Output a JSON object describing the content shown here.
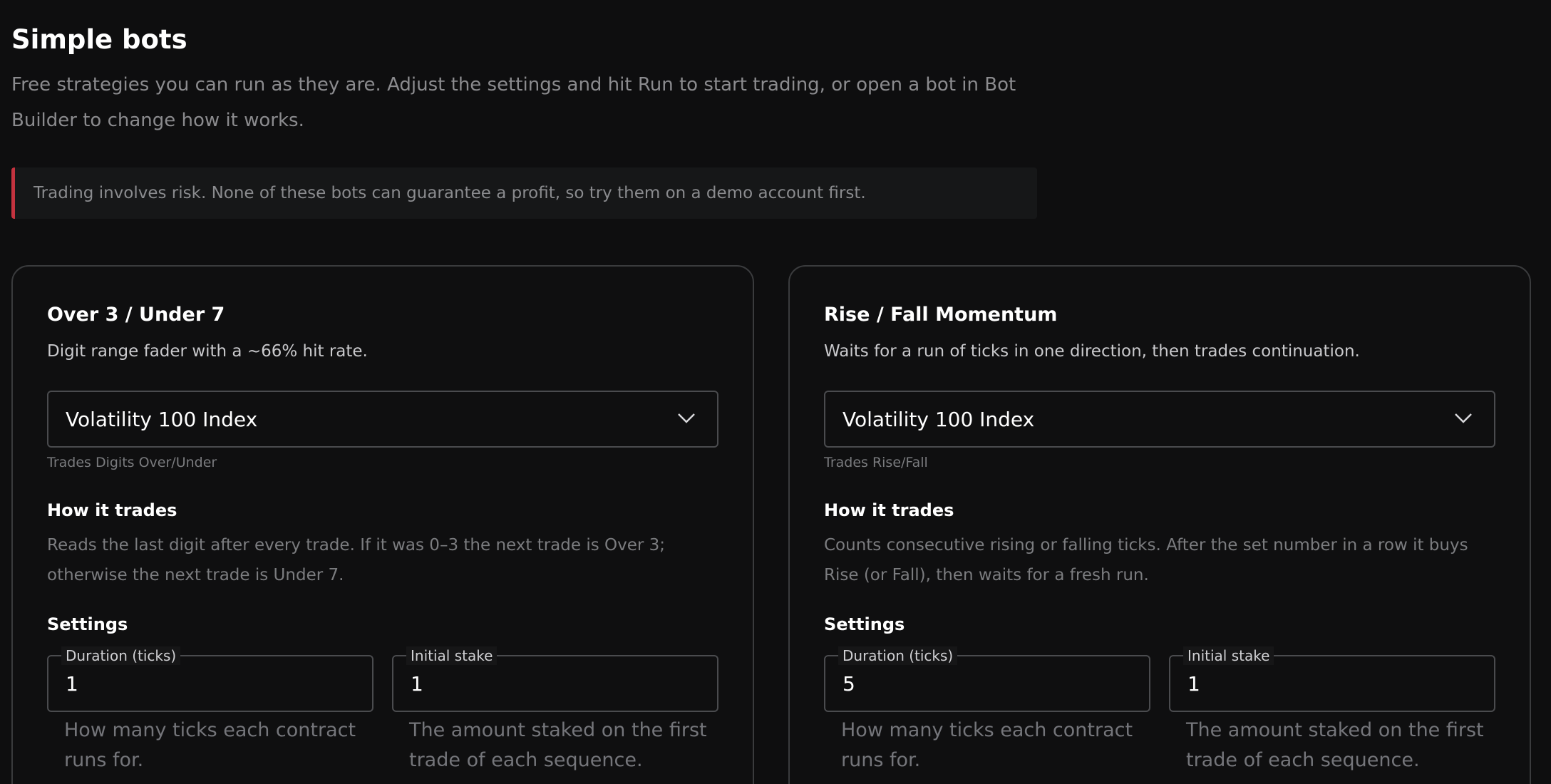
{
  "page": {
    "title": "Simple bots",
    "intro": "Free strategies you can run as they are. Adjust the settings and hit Run to start trading, or open a bot in Bot Builder to change how it works.",
    "warning": "Trading involves risk. None of these bots can guarantee a profit, so try them on a demo account first.",
    "warning_accent_color": "#c4333f"
  },
  "bots": [
    {
      "title": "Over 3 / Under 7",
      "description": "Digit range fader with a ~66% hit rate.",
      "market_select": "Volatility 100 Index",
      "market_help": "Trades Digits Over/Under",
      "how_heading": "How it trades",
      "how_text": "Reads the last digit after every trade. If it was 0–3 the next trade is Over 3; otherwise the next trade is Under 7.",
      "settings_heading": "Settings",
      "duration_label": "Duration (ticks)",
      "duration_value": "1",
      "duration_help": "How many ticks each contract runs for.",
      "stake_label": "Initial stake",
      "stake_value": "1",
      "stake_help": "The amount staked on the first trade of each sequence."
    },
    {
      "title": "Rise / Fall Momentum",
      "description": "Waits for a run of ticks in one direction, then trades continuation.",
      "market_select": "Volatility 100 Index",
      "market_help": "Trades Rise/Fall",
      "how_heading": "How it trades",
      "how_text": "Counts consecutive rising or falling ticks. After the set number in a row it buys Rise (or Fall), then waits for a fresh run.",
      "settings_heading": "Settings",
      "duration_label": "Duration (ticks)",
      "duration_value": "5",
      "duration_help": "How many ticks each contract runs for.",
      "stake_label": "Initial stake",
      "stake_value": "1",
      "stake_help": "The amount staked on the first trade of each sequence."
    }
  ],
  "icons": {
    "select_chevron": "chevron-down-icon"
  }
}
